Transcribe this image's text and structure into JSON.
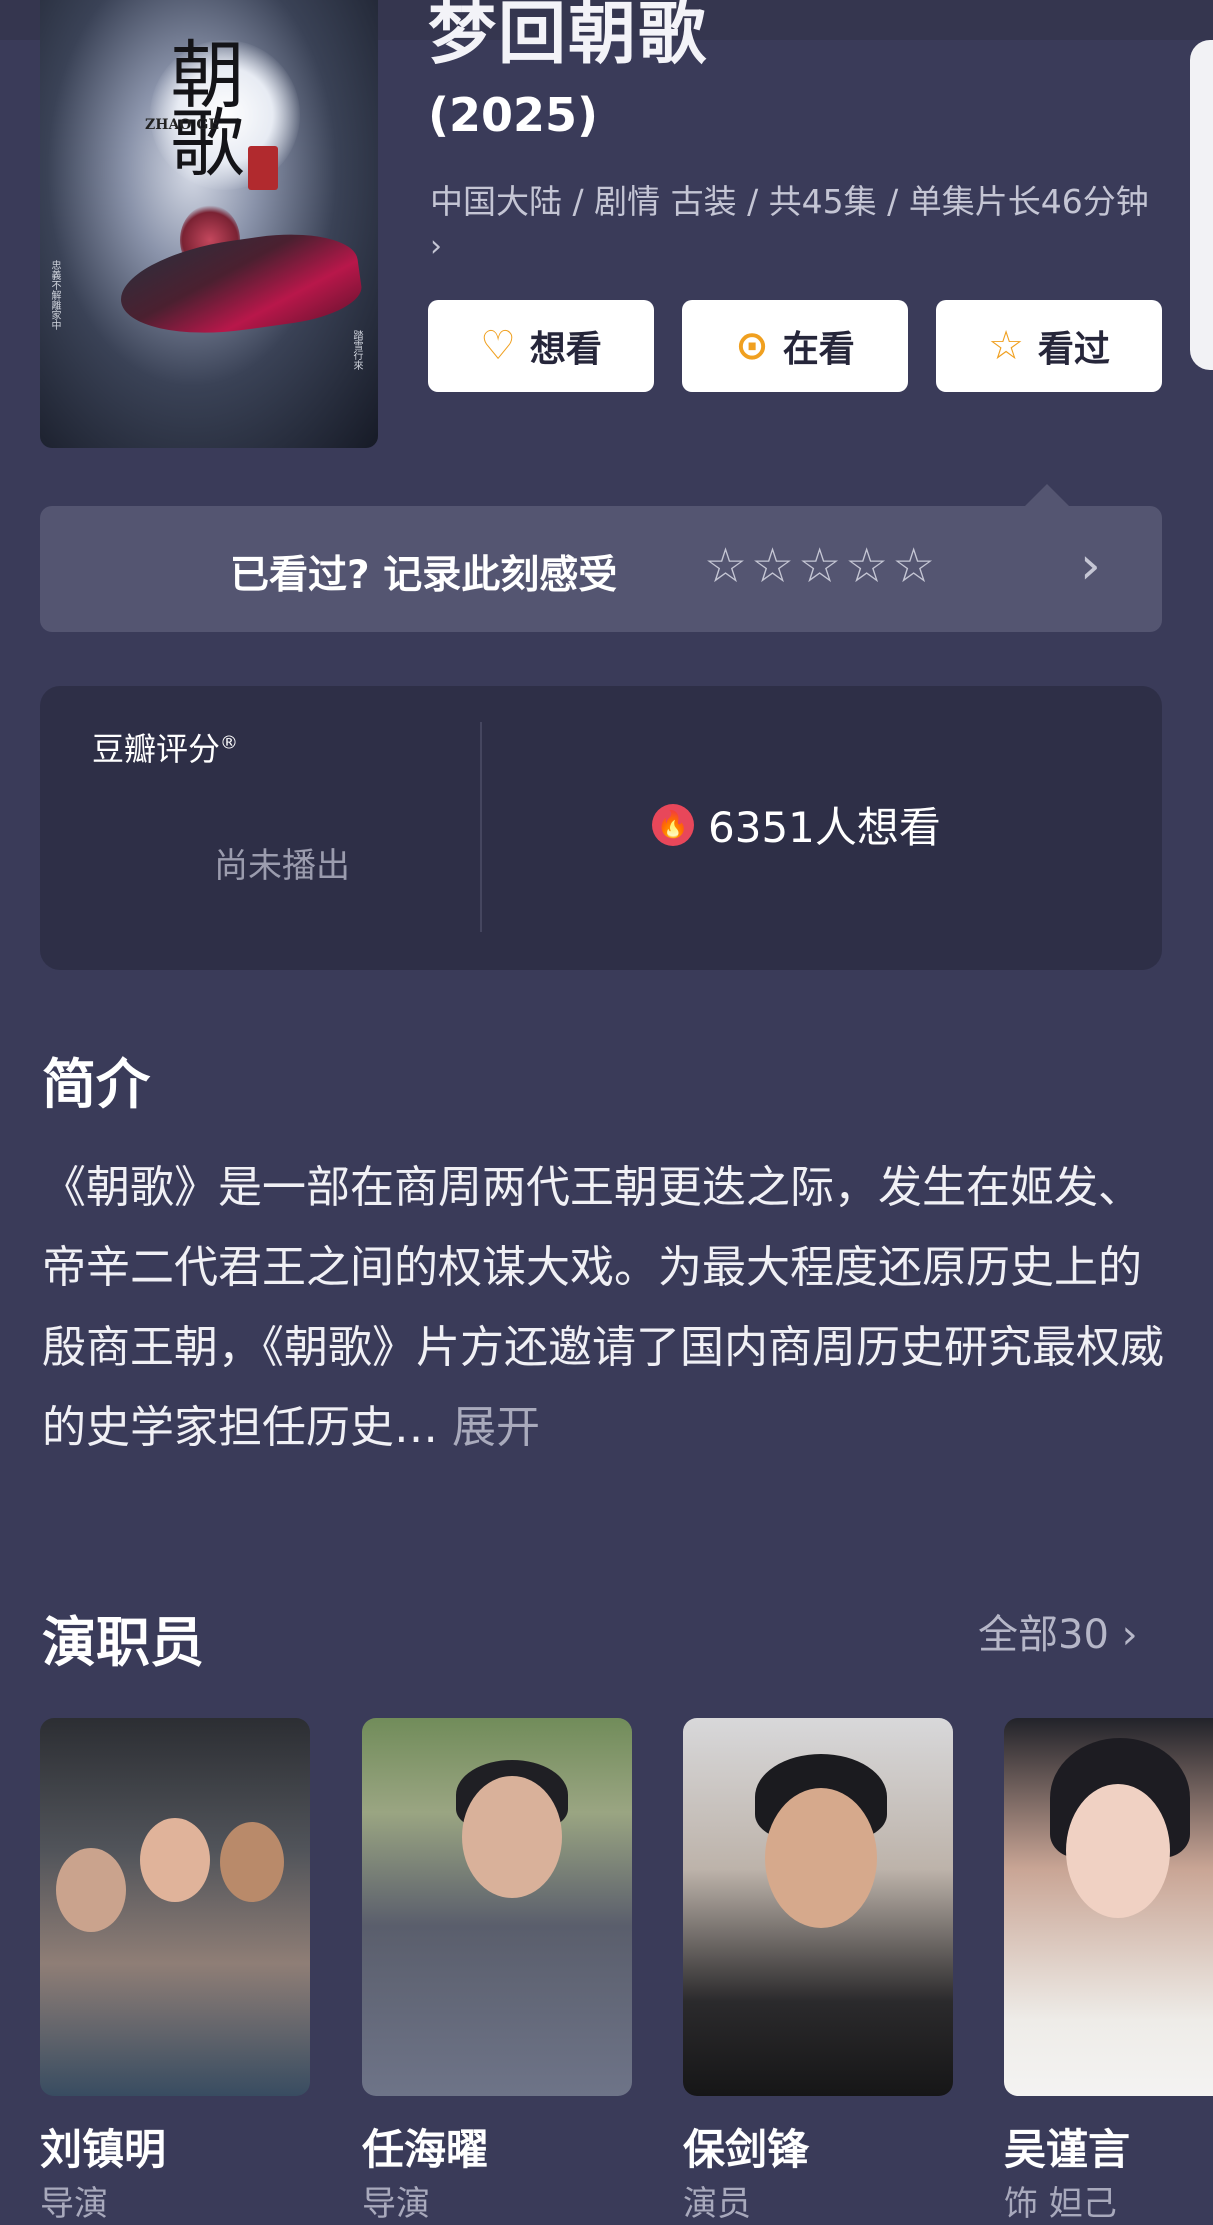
{
  "title": "梦回朝歌",
  "year": "(2025)",
  "meta": "中国大陆 / 剧情 古装 / 共45集 / 单集片长46分钟",
  "poster": {
    "title_glyph": "朝歌",
    "title_en": "ZHAO GE",
    "side_left": "忠義不解離家中",
    "side_right": "踏雪行來"
  },
  "actions": {
    "want_label": "想看",
    "watching_label": "在看",
    "watched_label": "看过"
  },
  "record": {
    "prompt": "已看过? 记录此刻感受",
    "stars": "☆☆☆☆☆"
  },
  "rating": {
    "label": "豆瓣评分",
    "label_mark": "®",
    "status": "尚未播出",
    "want_count": "6351人想看"
  },
  "intro": {
    "heading": "简介",
    "text": "《朝歌》是一部在商周两代王朝更迭之际，发生在姬发、帝辛二代君王之间的权谋大戏。为最大程度还原历史上的殷商王朝，《朝歌》片方还邀请了国内商周历史研究最权威的史学家担任历史…",
    "more": "展开"
  },
  "cast": {
    "heading": "演职员",
    "all_label": "全部30",
    "members": [
      {
        "name": "刘镇明",
        "role": "导演"
      },
      {
        "name": "任海曜",
        "role": "导演"
      },
      {
        "name": "保剑锋",
        "role": "演员"
      },
      {
        "name": "吴谨言",
        "role": "饰 妲己"
      }
    ]
  },
  "colors": {
    "background": "#3a3b59",
    "card": "#2e2f47",
    "record_bar": "#545571",
    "accent": "#f0a020",
    "fire": "#e8475a"
  }
}
